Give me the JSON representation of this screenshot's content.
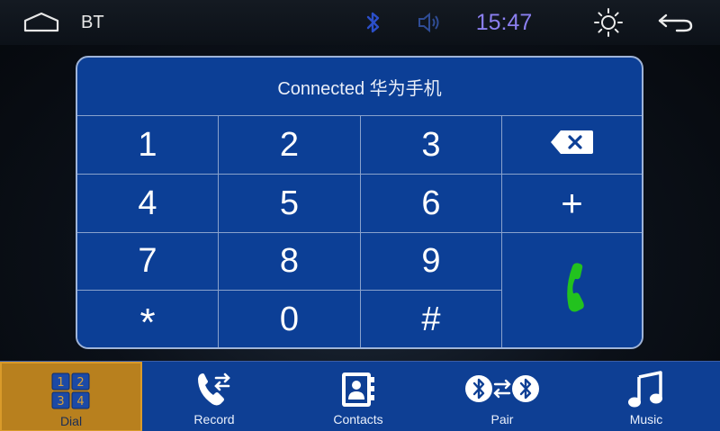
{
  "statusbar": {
    "app_label": "BT",
    "time": "15:47",
    "icons": [
      "home-icon",
      "bluetooth-icon",
      "volume-icon",
      "brightness-icon",
      "back-icon"
    ]
  },
  "dialer": {
    "header": "Connected 华为手机",
    "keys": [
      "1",
      "2",
      "3",
      "4",
      "5",
      "6",
      "7",
      "8",
      "9",
      "*",
      "0",
      "#"
    ],
    "plus": "+",
    "icons": [
      "backspace-icon",
      "call-icon"
    ]
  },
  "nav": {
    "tabs": [
      {
        "label": "Dial",
        "icon": "dialpad-icon",
        "active": true
      },
      {
        "label": "Record",
        "icon": "call-record-icon",
        "active": false
      },
      {
        "label": "Contacts",
        "icon": "contacts-icon",
        "active": false
      },
      {
        "label": "Pair",
        "icon": "pair-icon",
        "active": false
      },
      {
        "label": "Music",
        "icon": "music-icon",
        "active": false
      }
    ]
  },
  "colors": {
    "panel": "#0c3f96",
    "nav_bg": "#0e3f94",
    "active_tab": "#b8801e",
    "clock": "#8b7ff0",
    "call_green": "#22c21e"
  }
}
